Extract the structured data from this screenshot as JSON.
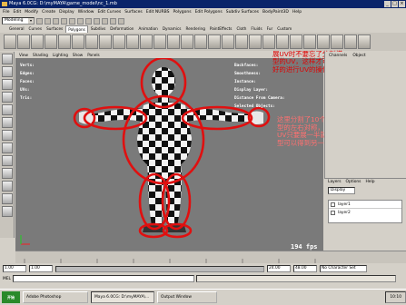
{
  "window": {
    "title": "Maya 6.0CG: D:\\myMAYA\\game_model\\nc_1.mb"
  },
  "menubar": [
    "File",
    "Edit",
    "Modify",
    "Create",
    "Display",
    "Window",
    "Edit Curves",
    "Surfaces",
    "Edit NURBS",
    "Polygons",
    "Edit Polygons",
    "Subdiv Surfaces",
    "BodyPaint3D",
    "Help"
  ],
  "modeMenu": {
    "value": "Modeling"
  },
  "shelfTabs": [
    "General",
    "Curves",
    "Surfaces",
    "Polygons",
    "Subdivs",
    "Deformation",
    "Animation",
    "Dynamics",
    "Rendering",
    "PaintEffects",
    "Cloth",
    "Fluids",
    "Fur",
    "Custom"
  ],
  "viewportMenu": [
    "View",
    "Shading",
    "Lighting",
    "Show",
    "Panels"
  ],
  "hudLeft": [
    "Verts:",
    "Edges:",
    "Faces:",
    "UVs:",
    "Tris:"
  ],
  "hudRight": [
    "Backfaces:",
    "Smoothness:",
    "Instance:",
    "Display Layer:",
    "Distance From Camera:",
    "Selected Objects:"
  ],
  "fps": "194 fps",
  "annotations": {
    "top": "展UV时不要忘了分割模型的UV，这样才可以更好的进行UV的操作。",
    "bottom": "这里分割了10个部分的UV，如果模型的左右对称，除了头以外，身体的UV只要展一半就OK了，然后镜像模型可以得到另一半的UV哦"
  },
  "channelBox": {
    "tabs": [
      "Channels",
      "Object"
    ],
    "menu": [
      "Layers",
      "Options",
      "Help"
    ],
    "displayValue": "Display",
    "layers": [
      "layer1",
      "layer2"
    ]
  },
  "range": {
    "start": "1.00",
    "end": "1.00",
    "playStart": "24.00",
    "playEnd": "48.00",
    "charSet": "No Character Set"
  },
  "cmdPrefix": "MEL",
  "taskbar": {
    "start": "开始",
    "tasks": [
      "Adobe Photoshop",
      "Maya 6.0CG: D:\\myMAYA\\...",
      "Output Window"
    ],
    "clock": "10:10"
  }
}
